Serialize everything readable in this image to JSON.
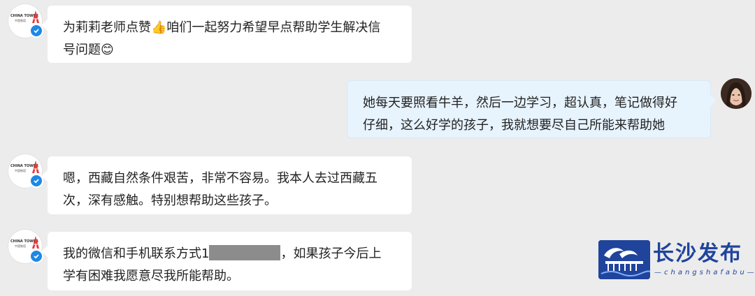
{
  "avatars": {
    "tower_line1": "CHINA TOWER",
    "tower_line2": "中国铁塔",
    "verified_icon": "check-icon",
    "user_icon": "user-photo-avatar"
  },
  "messages": [
    {
      "side": "left",
      "line1": "为莉莉老师点赞👍咱们一起努力希望早点帮助学生解决信",
      "line2": "号问题😊"
    },
    {
      "side": "right",
      "line1": "她每天要照看牛羊，然后一边学习，超认真，笔记做得好",
      "line2": "仔细，这么好学的孩子，我就想要尽自己所能来帮助她"
    },
    {
      "side": "left",
      "line1": "嗯，西藏自然条件艰苦，非常不容易。我本人去过西藏五",
      "line2": "次，深有感触。特别想帮助这些孩子。"
    },
    {
      "side": "left",
      "line1_prefix": "我的微信和手机联系方式1",
      "line1_suffix": "，如果孩子今后上",
      "line2": "学有困难我愿意尽我所能帮助。"
    }
  ],
  "watermark": {
    "title": "长沙发布",
    "subtitle": "—changshafabu—"
  },
  "colors": {
    "background": "#ececec",
    "bubble_left": "#ffffff",
    "bubble_right": "#e7f3fd",
    "verified": "#1e88e5",
    "watermark_blue": "#20449c"
  }
}
